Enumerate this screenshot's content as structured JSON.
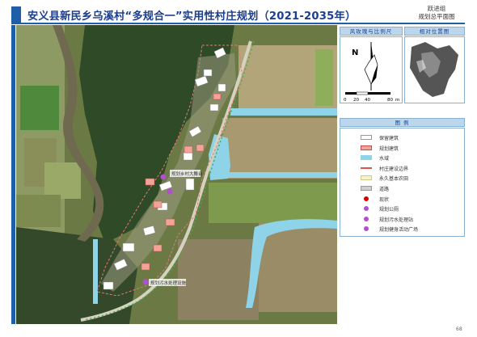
{
  "header": {
    "title": "安义县新民乡乌溪村“多规合一”实用性村庄规划（2021-2035年）",
    "subtitle_line1": "跃进组",
    "subtitle_line2": "规划总平面图"
  },
  "map": {
    "callout_1": "规划乡村大舞台",
    "callout_2": "规划污水处理设施"
  },
  "scale_panel": {
    "header": "风玫瑰与比例尺",
    "north_label": "N",
    "scale_ticks": [
      "0",
      "20",
      "40",
      "80"
    ],
    "unit": "m"
  },
  "location_panel": {
    "header": "相对位置图"
  },
  "legend": {
    "header": "图 例",
    "items": [
      {
        "label": "保留建筑",
        "swatch": "#ffffff",
        "border": "#999999"
      },
      {
        "label": "规划建筑",
        "swatch": "#f2a39a",
        "border": "#c0504d"
      },
      {
        "label": "水域",
        "swatch": "#8fd3e8",
        "border": "#8fd3e8"
      },
      {
        "label": "村庄建设边界",
        "swatch": "line-red",
        "border": "#d9534f"
      },
      {
        "label": "永久基本农田",
        "swatch": "#f5f3c8",
        "border": "#cccc88"
      },
      {
        "label": "道路",
        "swatch": "#cfcfcf",
        "border": "#999999"
      },
      {
        "label": "现状",
        "swatch": "dot-red",
        "border": "#d40000"
      },
      {
        "label": "规划公厕",
        "swatch": "dot-purple",
        "border": "#b24fd0"
      },
      {
        "label": "规划污水处理站",
        "swatch": "dot-purple",
        "border": "#b24fd0"
      },
      {
        "label": "规划健身活动广场",
        "swatch": "dot-purple",
        "border": "#b24fd0"
      }
    ]
  },
  "page_number": "68",
  "colors": {
    "accent": "#1f5fa8",
    "water": "#8fd3e8",
    "planned_building": "#f2a39a"
  }
}
